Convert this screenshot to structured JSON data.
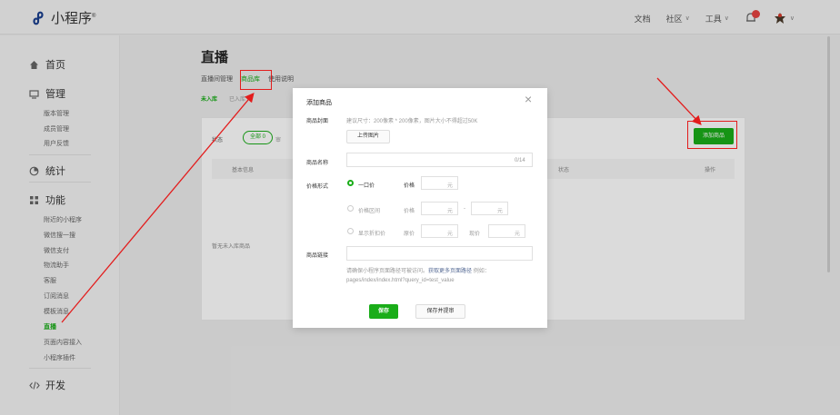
{
  "topbar": {
    "brand": "小程序",
    "brand_mark": "®",
    "nav": [
      {
        "label": "文档",
        "has_caret": false
      },
      {
        "label": "社区",
        "has_caret": true
      },
      {
        "label": "工具",
        "has_caret": true
      }
    ],
    "caret": "∨"
  },
  "sidebar": {
    "groups": [
      {
        "label": "首页",
        "icon": "home-icon"
      },
      {
        "label": "管理",
        "icon": "monitor-icon",
        "items": [
          "版本管理",
          "成员管理",
          "用户反馈"
        ]
      },
      {
        "label": "统计",
        "icon": "chart-icon"
      },
      {
        "label": "功能",
        "icon": "grid-icon",
        "items": [
          "附近的小程序",
          "微信搜一搜",
          "微信支付",
          "物流助手",
          "客服",
          "订阅消息",
          "模板消息",
          "直播",
          "页面内容接入",
          "小程序插件"
        ],
        "active_item": "直播"
      },
      {
        "label": "开发",
        "icon": "code-icon"
      }
    ]
  },
  "page": {
    "title": "直播",
    "tabs": [
      "直播间管理",
      "商品库",
      "使用说明"
    ],
    "active_tab": "商品库",
    "subtabs": [
      "未入库",
      "已入库"
    ],
    "status_label": "状态",
    "status_pill": "全部 0",
    "status_pill2": "审",
    "add_button": "添加商品",
    "table_headers": [
      "基本信息",
      "状态",
      "操作"
    ],
    "empty_text": "暂无未入库商品"
  },
  "modal": {
    "title": "添加商品",
    "close": "×",
    "cover": {
      "label": "商品封面",
      "hint": "建议尺寸：200像素 * 200像素，图片大小不得超过50K",
      "upload_button": "上传图片"
    },
    "name": {
      "label": "商品名称",
      "counter": "0/14"
    },
    "price": {
      "label": "价格形式",
      "options": [
        {
          "label": "一口价",
          "selected": true,
          "fields": [
            {
              "label": "价格",
              "unit": "元"
            }
          ]
        },
        {
          "label": "价格区间",
          "selected": false,
          "fields": [
            {
              "label": "价格",
              "unit": "元"
            },
            {
              "label": "",
              "unit": "元"
            }
          ],
          "separator": "-"
        },
        {
          "label": "显示折扣价",
          "selected": false,
          "fields": [
            {
              "label": "原价",
              "unit": "元"
            },
            {
              "label": "现价",
              "unit": "元"
            }
          ]
        }
      ]
    },
    "link": {
      "label": "商品链接",
      "hint_prefix": "请确保小程序页面路径可被访问。",
      "hint_link": "获取更多页面路径",
      "hint_suffix": " 例如：pages/index/index.html?query_id=test_value"
    },
    "save_button": "保存",
    "save_audit_button": "保存并提审"
  },
  "annotation_color": "#e31c1c",
  "accent_color": "#1aad19"
}
